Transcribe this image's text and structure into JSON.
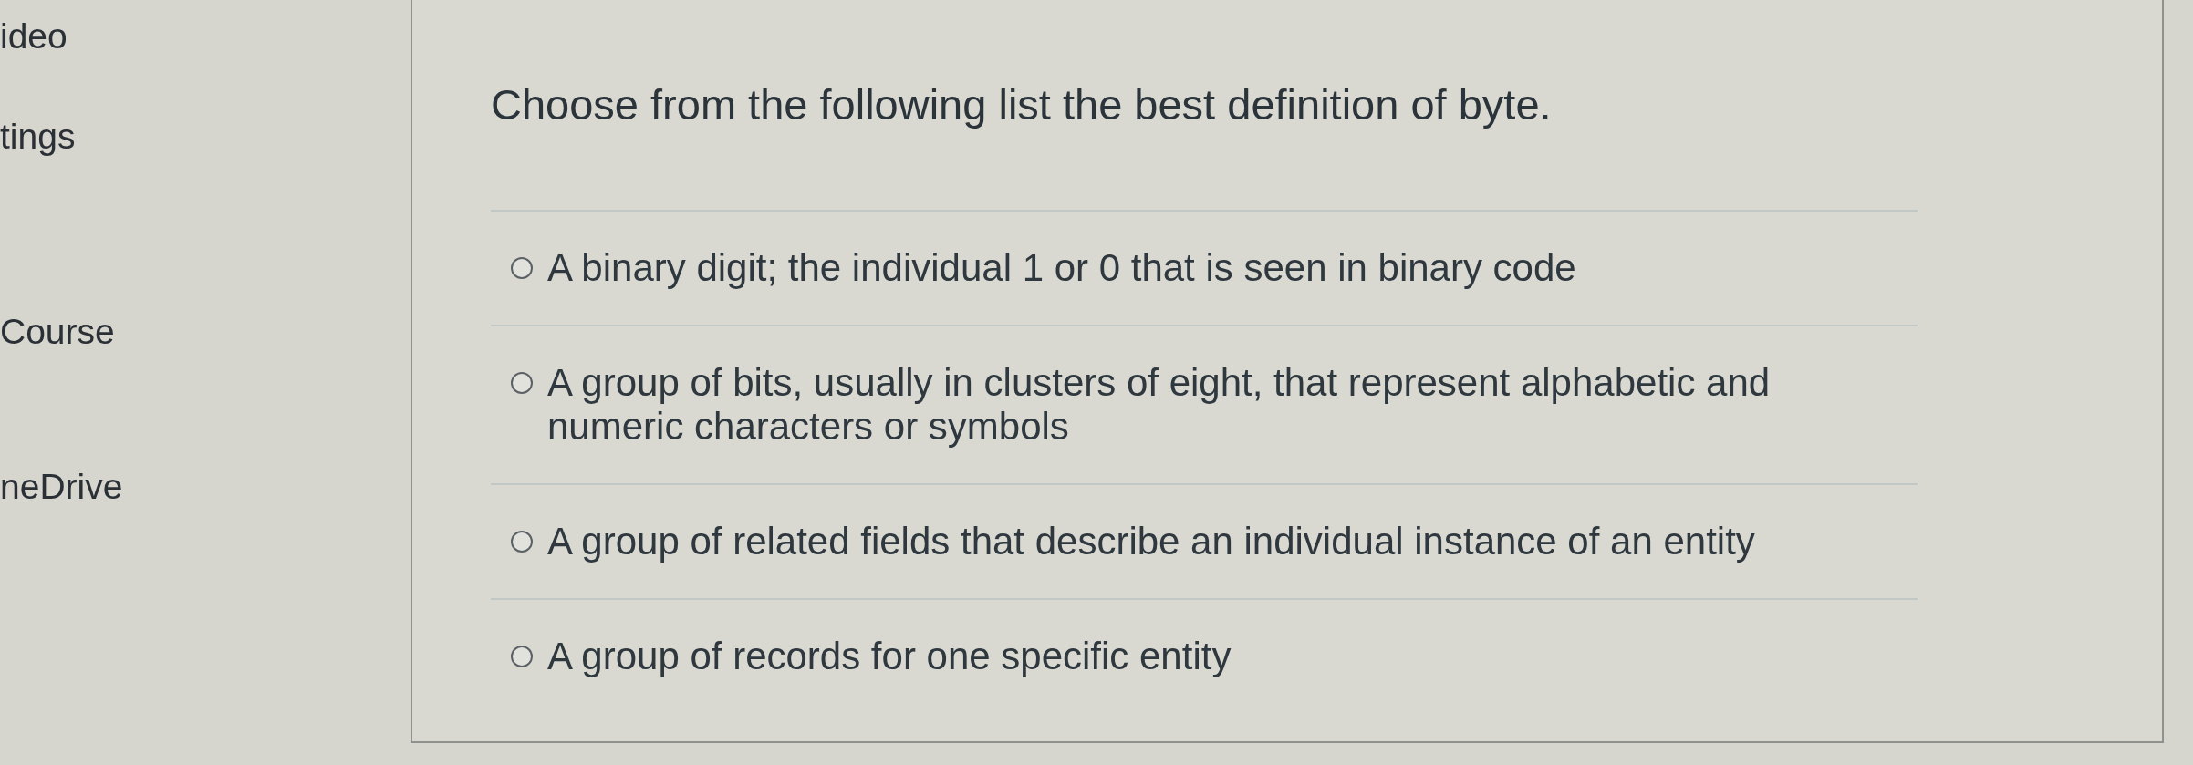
{
  "sidebar": {
    "items": [
      {
        "label": "ideo"
      },
      {
        "label": "tings"
      },
      {
        "label": "Course"
      },
      {
        "label": "neDrive"
      }
    ]
  },
  "question": {
    "text": "Choose from the following list the best definition of byte.",
    "options": [
      {
        "label": "A binary digit; the individual 1 or 0 that is seen in binary code",
        "selected": false
      },
      {
        "label": "A group of bits, usually in clusters of eight, that represent alphabetic and numeric characters or symbols",
        "selected": false
      },
      {
        "label": "A group of related fields that describe an individual instance of an entity",
        "selected": false
      },
      {
        "label": "A group of records for one specific entity",
        "selected": false
      }
    ]
  }
}
